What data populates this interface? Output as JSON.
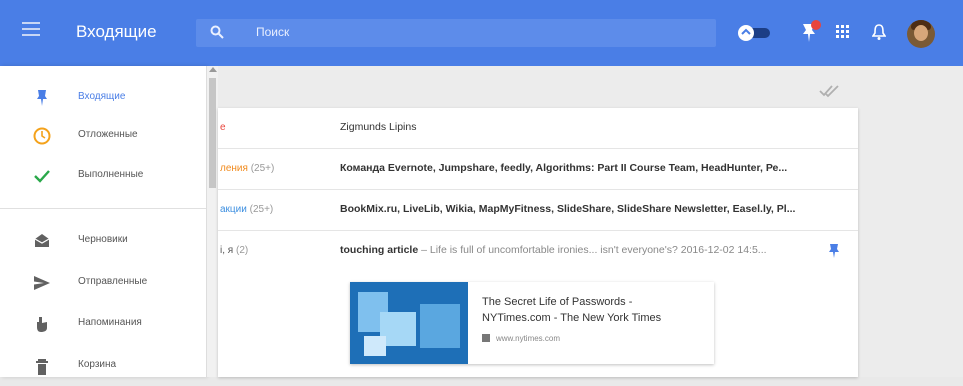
{
  "header": {
    "title": "Входящие",
    "search_placeholder": "Поиск"
  },
  "drawer": {
    "items": [
      {
        "label": "Входящие",
        "icon": "pin-icon"
      },
      {
        "label": "Отложенные",
        "icon": "clock-icon"
      },
      {
        "label": "Выполненные",
        "icon": "check-icon"
      },
      {
        "label": "Черновики",
        "icon": "drafts-icon"
      },
      {
        "label": "Отправленные",
        "icon": "send-icon"
      },
      {
        "label": "Напоминания",
        "icon": "reminder-icon"
      },
      {
        "label": "Корзина",
        "icon": "trash-icon"
      }
    ]
  },
  "rows": [
    {
      "label": "е",
      "count": "",
      "senders": "Zigmunds Lipins",
      "snippet": ""
    },
    {
      "label": "ления",
      "count": "(25+)",
      "senders": "Команда Evernote, Jumpshare, feedly, Algorithms: Part II Course Team, HeadHunter, Ре...",
      "snippet": ""
    },
    {
      "label": "акции",
      "count": "(25+)",
      "senders": "BookMix.ru, LiveLib, Wikia, MapMyFitness, SlideShare, SlideShare Newsletter, Easel.ly, Pl...",
      "snippet": ""
    },
    {
      "label": "i, я",
      "count": "(2)",
      "senders": "touching article",
      "snippet": " – Life is full of uncomfortable ironies... isn't everyone's? 2016-12-02 14:5..."
    }
  ],
  "preview": {
    "title": "The Secret Life of Passwords - NYTimes.com - The New York Times",
    "url": "www.nytimes.com"
  },
  "colors": {
    "brand": "#4a7ee6",
    "pin_blue": "#4a7ee6",
    "clock_orange": "#f4a21b",
    "check_green": "#2aa84a",
    "label_red": "#e8453c",
    "label_orange": "#f08a1d",
    "label_blue": "#3d8fe0"
  }
}
